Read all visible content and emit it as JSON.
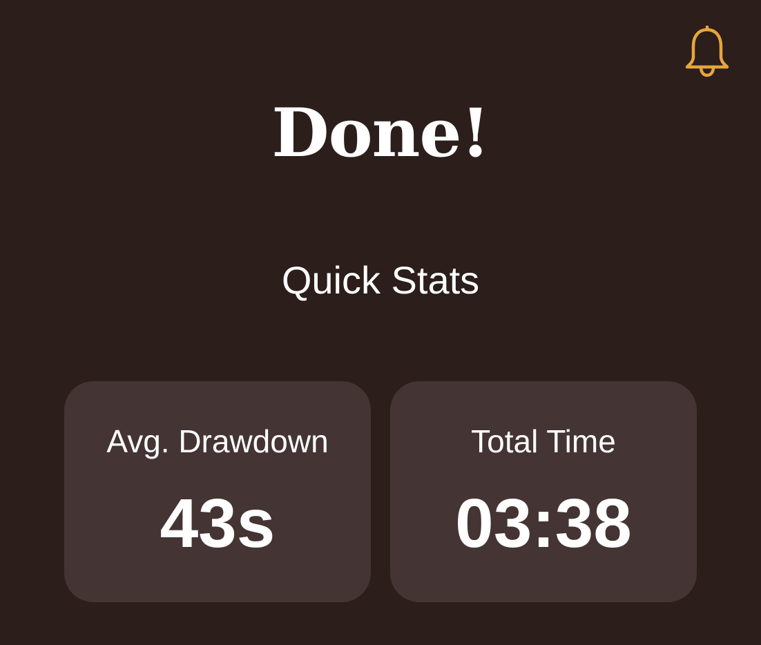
{
  "header": {
    "bell_icon": "bell-icon",
    "accent_color": "#e8a53c"
  },
  "main": {
    "title": "Done!",
    "section_title": "Quick Stats",
    "stats": [
      {
        "label": "Avg. Drawdown",
        "value": "43s"
      },
      {
        "label": "Total Time",
        "value": "03:38"
      }
    ]
  },
  "colors": {
    "background": "#2b1e1b",
    "card_background": "#443433",
    "text": "#ffffff"
  }
}
